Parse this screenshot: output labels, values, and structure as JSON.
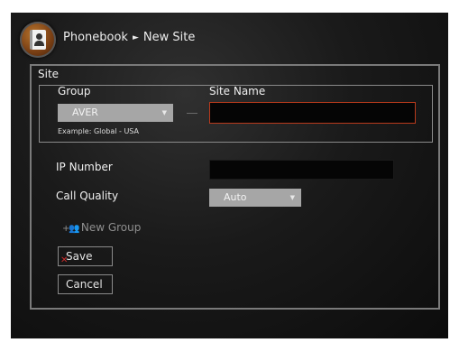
{
  "header": {
    "breadcrumb_root": "Phonebook",
    "breadcrumb_separator": "►",
    "breadcrumb_current": "New Site",
    "icon": "phonebook-icon"
  },
  "site": {
    "title": "Site",
    "group_label": "Group",
    "group_value": "AVER",
    "group_example": "Example: Global - USA",
    "site_name_label": "Site Name",
    "site_name_value": "",
    "ip_label": "IP Number",
    "ip_value": "",
    "call_quality_label": "Call Quality",
    "call_quality_value": "Auto",
    "dropdown_caret": "▼"
  },
  "actions": {
    "new_group_icon": "+👥",
    "new_group_label": "New Group",
    "save_label": "Save",
    "cancel_label": "Cancel"
  },
  "colors": {
    "focus_border": "#b93a1c",
    "select_bg": "#a6a6a6",
    "panel_border": "#7a7a7a"
  }
}
